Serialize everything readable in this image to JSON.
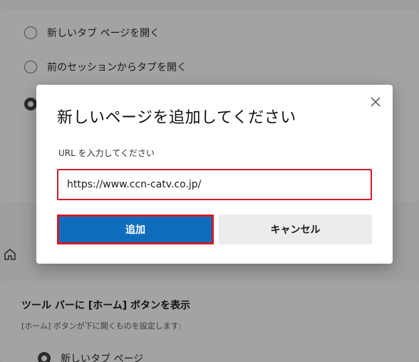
{
  "background": {
    "radio_options": [
      {
        "label": "新しいタブ ページを開く",
        "checked": false
      },
      {
        "label": "前のセッションからタブを開く",
        "checked": false
      },
      {
        "label": "",
        "checked": true
      }
    ],
    "toolbar_heading": "ツール バーに [ホーム] ボタンを表示",
    "toolbar_description": "[ホーム] ボタンが下に開くものを設定します:",
    "home_option_label": "新しいタブ ページ"
  },
  "dialog": {
    "title": "新しいページを追加してください",
    "url_label": "URL を入力してください",
    "url_value": "https://www.ccn-catv.co.jp/",
    "add_label": "追加",
    "cancel_label": "キャンセル"
  },
  "colors": {
    "primary_button": "#0f6cbd",
    "highlight_border": "#d11a2a",
    "overlay": "#9e9e9e"
  }
}
